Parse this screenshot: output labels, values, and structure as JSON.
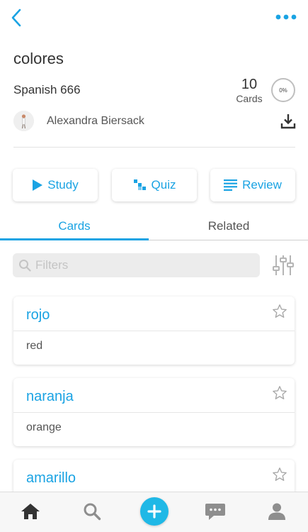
{
  "header": {
    "back_icon": "chevron-left-icon",
    "more_icon": "ellipsis-icon"
  },
  "set": {
    "title": "colores",
    "course": "Spanish 666",
    "card_count": "10",
    "card_count_label": "Cards",
    "progress_label": "0%",
    "progress_fraction": 0,
    "author": "Alexandra Biersack"
  },
  "modes": {
    "study": "Study",
    "quiz": "Quiz",
    "review": "Review"
  },
  "tabs": {
    "cards": "Cards",
    "related": "Related",
    "active": "cards"
  },
  "filter": {
    "placeholder": "Filters"
  },
  "cards": [
    {
      "term": "rojo",
      "definition": "red"
    },
    {
      "term": "naranja",
      "definition": "orange"
    },
    {
      "term": "amarillo",
      "definition": ""
    }
  ],
  "nav": {
    "items": [
      "home-icon",
      "search-icon",
      "add-icon",
      "chat-icon",
      "profile-icon"
    ]
  },
  "colors": {
    "accent": "#1aa3e3",
    "fab": "#1fb8e6",
    "text": "#333333",
    "muted": "#555555"
  }
}
